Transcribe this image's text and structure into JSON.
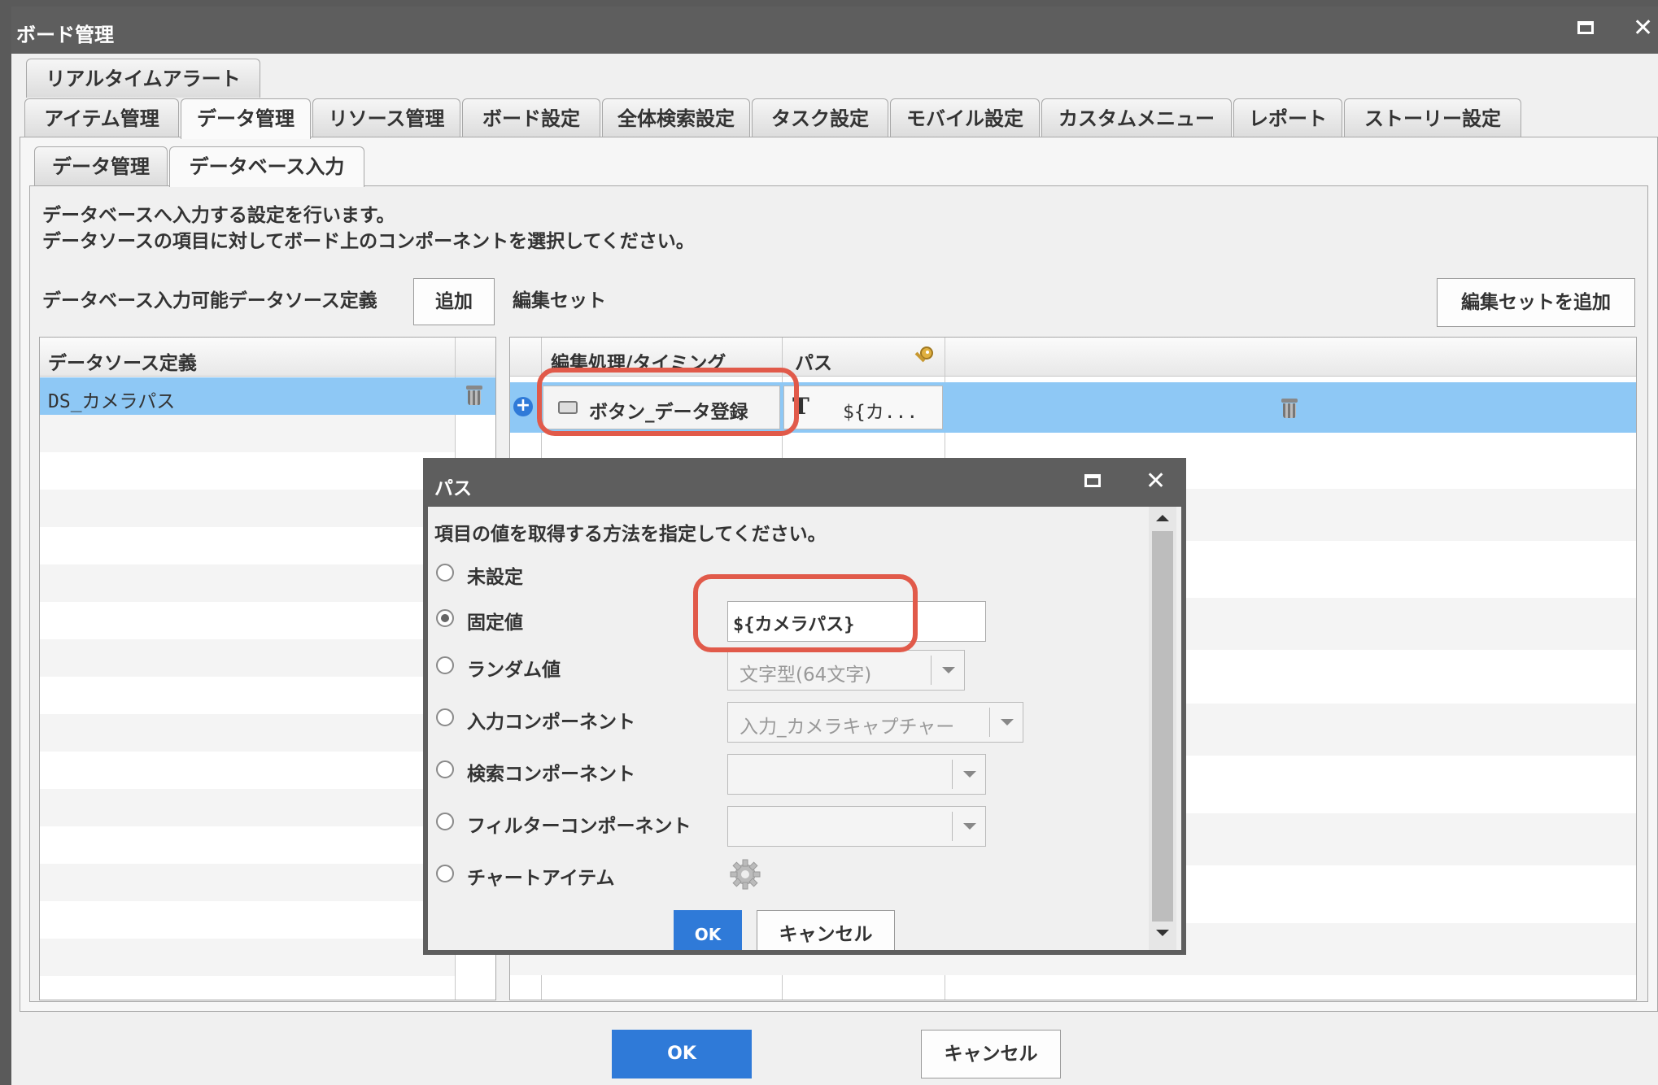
{
  "window": {
    "title": "ボード管理",
    "maximize_icon": "maximize-icon",
    "close_icon": "close-icon",
    "close_glyph": "✕"
  },
  "top_tabs_row1": [
    "リアルタイムアラート"
  ],
  "top_tabs_row2": [
    "アイテム管理",
    "データ管理",
    "リソース管理",
    "ボード設定",
    "全体検索設定",
    "タスク設定",
    "モバイル設定",
    "カスタムメニュー",
    "レポート",
    "ストーリー設定"
  ],
  "active_top_tab": "データ管理",
  "sub_tabs": [
    "データ管理",
    "データベース入力"
  ],
  "active_sub_tab": "データベース入力",
  "description": {
    "line1": "データベースへ入力する設定を行います。",
    "line2": "データソースの項目に対してボード上のコンポーネントを選択してください。"
  },
  "left_section": {
    "label": "データベース入力可能データソース定義",
    "add_button": "追加",
    "column_header": "データソース定義",
    "rows": [
      "DS_カメラパス"
    ]
  },
  "right_section": {
    "label": "編集セット",
    "add_button": "編集セットを追加",
    "columns": [
      "編集処理/タイミング",
      "パス"
    ],
    "key_icon": "key-icon",
    "row": {
      "timing": "ボタン_データ登録",
      "type_glyph": "T",
      "path": "${カ..."
    }
  },
  "dialog": {
    "title": "パス",
    "instruction": "項目の値を取得する方法を指定してください。",
    "options": [
      {
        "label": "未設定",
        "selected": false
      },
      {
        "label": "固定値",
        "selected": true
      },
      {
        "label": "ランダム値",
        "selected": false
      },
      {
        "label": "入力コンポーネント",
        "selected": false
      },
      {
        "label": "検索コンポーネント",
        "selected": false
      },
      {
        "label": "フィルターコンポーネント",
        "selected": false
      },
      {
        "label": "チャートアイテム",
        "selected": false
      }
    ],
    "fixed_value": "${カメラパス}",
    "random_type": "文字型(64文字)",
    "input_component": "入力_カメラキャプチャー",
    "search_component": "",
    "filter_component": "",
    "chart_icon": "gear-icon",
    "ok": "OK",
    "cancel": "キャンセル"
  },
  "footer": {
    "ok": "OK",
    "cancel": "キャンセル"
  },
  "colors": {
    "accent_blue": "#2f7ad8",
    "selected_row": "#8ec8f5",
    "highlight": "#e15a4a",
    "titlebar": "#5e5e5e"
  }
}
